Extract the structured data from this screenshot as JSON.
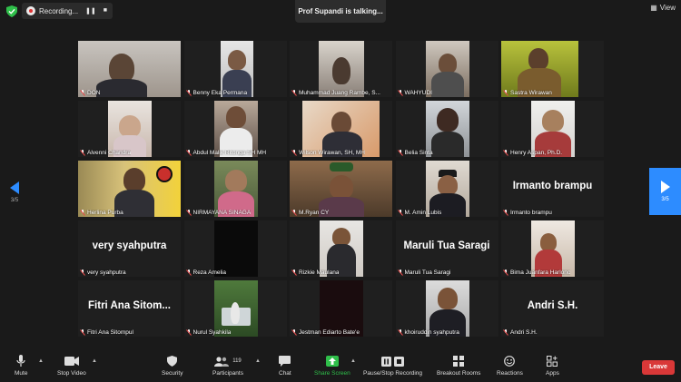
{
  "top": {
    "recording_label": "Recording...",
    "talking_label": "Prof Supandi is talking...",
    "view_label": "View"
  },
  "pager": {
    "left_label": "3/5",
    "right_label": "3/5"
  },
  "participants": [
    "DON",
    "Benny Eka Permana",
    "Muhammad Juang Rambe, S...",
    "WAHYUDI",
    "Sastra Wirawan",
    "Alvenni Chandra",
    "Abdul Malik Ritonga SH MH",
    "Wilson Wirawan, SH, MH",
    "Belia Sinta",
    "Henry Aspan, Ph.D.",
    "Herlina Purba",
    "NIRMAYANA SINAGA",
    "M.Ryan CY",
    "M. Amin Lubis",
    "Irmanto brampu",
    "very syahputra",
    "Reza Amelia",
    "Rizkie Maulana",
    "Maruli Tua Saragi",
    "Bima Juanfara Harlono",
    "Fitri Ana Sitompul",
    "Nurul Syahkila",
    "Jestman Ediarto Bate'e",
    "khoiruddin syahputra",
    "Andri S.H."
  ],
  "tile_big_names": {
    "irmanto": "Irmanto brampu",
    "very": "very syahputra",
    "maruli": "Maruli Tua Saragi",
    "fitri": "Fitri Ana Sitom...",
    "andri": "Andri S.H."
  },
  "toolbar": {
    "mute": "Mute",
    "stop_video": "Stop Video",
    "security": "Security",
    "participants": "Participants",
    "participants_count": "119",
    "chat": "Chat",
    "share_screen": "Share Screen",
    "pause_recording": "Pause/Stop Recording",
    "breakout_rooms": "Breakout Rooms",
    "reactions": "Reactions",
    "apps": "Apps",
    "leave": "Leave"
  },
  "colors": {
    "accent": "#2d8cff",
    "leave": "#d93838",
    "share": "#2fbf4a",
    "muted_mic": "#e04b4b"
  }
}
